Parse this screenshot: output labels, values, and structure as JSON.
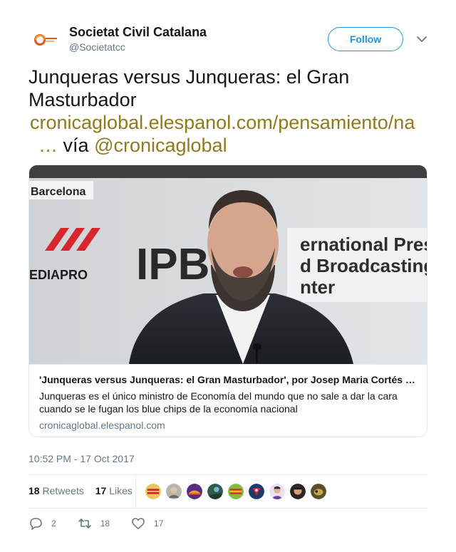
{
  "author": {
    "name": "Societat Civil Catalana",
    "handle": "@Societatcc"
  },
  "follow_label": "Follow",
  "text": {
    "line1": "Junqueras versus Junqueras: el Gran",
    "line2": "Masturbador",
    "link": "cronicaglobal.elespanol.com/pensamiento/na",
    "ellipsis": "…",
    "via": "vía",
    "mention": "@cronicaglobal"
  },
  "card": {
    "image_text_barcelona": "Barcelona",
    "image_text_mediapro": "EDIAPRO",
    "image_text_ipb": "IPB",
    "image_text_banner_1": "ernational Press",
    "image_text_banner_2": "d Broadcasting",
    "image_text_banner_3": "nter",
    "title": "'Junqueras versus Junqueras: el Gran Masturbador', por Josep Maria Cortés …",
    "description": "Junqueras es el único ministro de Economía del mundo que no sale a dar la cara cuando se le fugan los blue chips de la economía nacional",
    "domain": "cronicaglobal.elespanol.com"
  },
  "timestamp": "10:52 PM - 17 Oct 2017",
  "stats": {
    "retweets_count": "18",
    "retweets_label": "Retweets",
    "likes_count": "17",
    "likes_label": "Likes"
  },
  "actions": {
    "reply_count": "2",
    "retweet_count": "18",
    "like_count": "17"
  },
  "colors": {
    "link": "#8f7a1c",
    "accent": "#1b95e0",
    "muted": "#657786"
  }
}
